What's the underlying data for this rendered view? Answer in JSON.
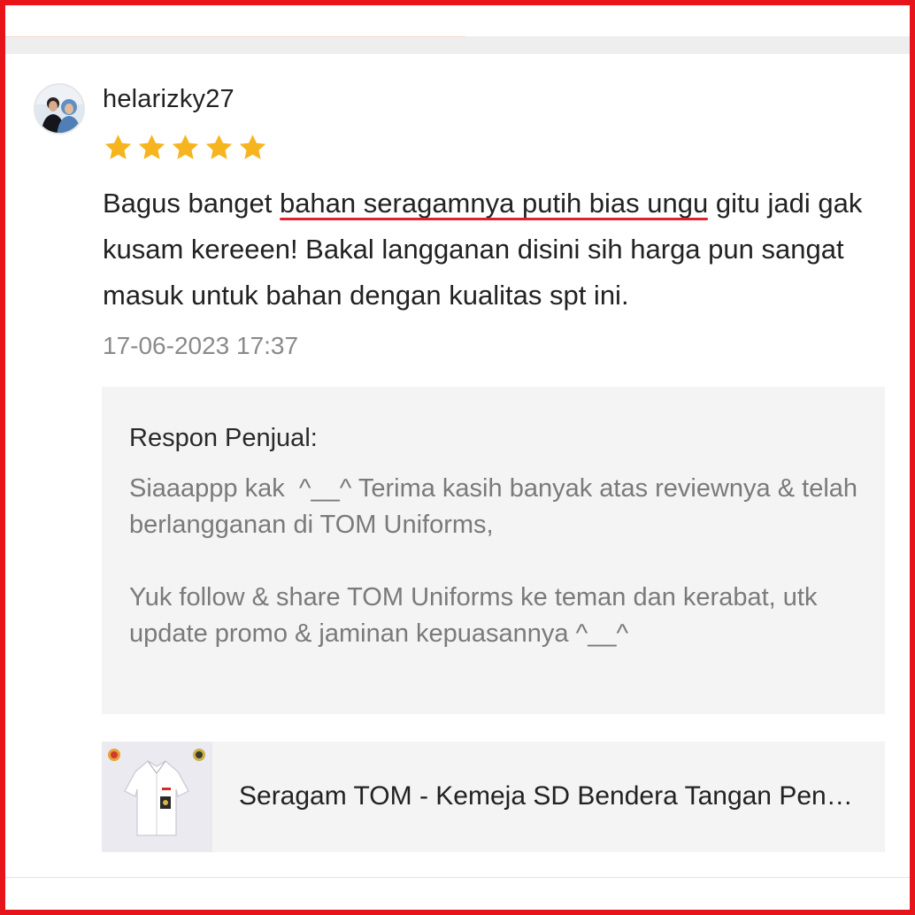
{
  "review": {
    "username": "helarizky27",
    "rating": 5,
    "rating_max": 5,
    "text": {
      "part1": "Bagus banget ",
      "highlight1": "bahan seragamnya putih bias ungu",
      "part2": " gitu ",
      "highlight2": "jadi gak kusam kereeen",
      "part3": "! Bakal langganan disini sih harga pun sangat masuk untuk bahan dengan kualitas spt ini."
    },
    "timestamp": "17-06-2023 17:37"
  },
  "seller_response": {
    "label": "Respon Penjual:",
    "text": "Siaaappp kak  ^__^ Terima kasih banyak atas reviewnya & telah berlangganan di TOM Uniforms,\n\nYuk follow & share TOM Uniforms ke teman dan kerabat, utk update promo & jaminan kepuasannya ^__^"
  },
  "product": {
    "name": "Seragam TOM - Kemeja SD Bendera Tangan Pendek"
  },
  "colors": {
    "border": "#e8141c",
    "star": "#f6b51e",
    "highlight_underline": "#e0202a"
  }
}
